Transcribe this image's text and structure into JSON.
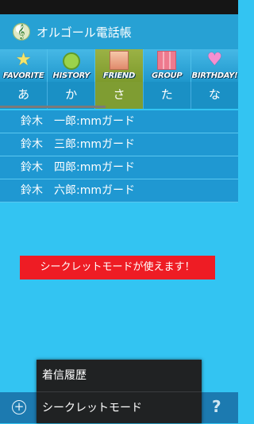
{
  "app": {
    "title": "オルゴール電話帳"
  },
  "tabs": [
    {
      "label": "FAVORITE",
      "icon": "star-icon"
    },
    {
      "label": "HISTORY",
      "icon": "clock-icon"
    },
    {
      "label": "FRIEND",
      "icon": "person-icon",
      "active": true
    },
    {
      "label": "GROUP",
      "icon": "group-icon"
    },
    {
      "label": "BIRTHDAY!",
      "icon": "heart-icon"
    }
  ],
  "kana": [
    "あ",
    "か",
    "さ",
    "た",
    "な"
  ],
  "contacts": [
    "鈴木　一郎:mmガード",
    "鈴木　三郎:mmガード",
    "鈴木　四郎:mmガード",
    "鈴木　六郎:mmガード"
  ],
  "banner": {
    "text": "シークレットモードが使えます！"
  },
  "menu": {
    "items": [
      "着信履歴",
      "シークレットモード"
    ]
  },
  "bottom": {
    "help": "?",
    "add": "+"
  },
  "colors": {
    "accent": "#27a1d4",
    "active_tab": "#7f9d32",
    "banner": "#ee1c24",
    "background": "#33c4f2"
  }
}
